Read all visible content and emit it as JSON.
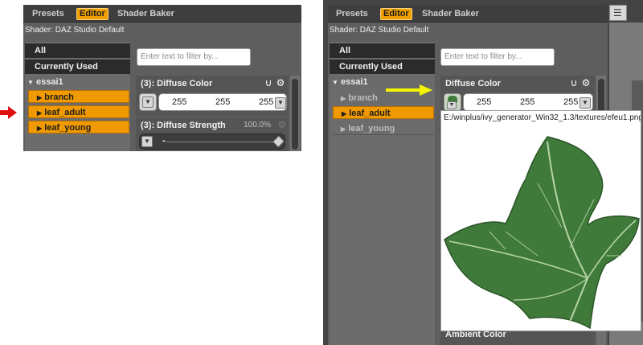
{
  "left": {
    "tabs": {
      "presets": "Presets",
      "editor": "Editor",
      "shader_baker": "Shader Baker"
    },
    "shader_label": "Shader: DAZ Studio Default",
    "filter_placeholder": "Enter text to filter by...",
    "list": {
      "all": "All",
      "currently_used": "Currently Used",
      "group": "essai1",
      "items": [
        "branch",
        "leaf_adult",
        "leaf_young"
      ]
    },
    "props": {
      "diffuse_color": {
        "label": "(3): Diffuse Color",
        "r": "255",
        "g": "255",
        "b": "255"
      },
      "diffuse_strength": {
        "label": "(3): Diffuse Strength",
        "value": "100.0%",
        "slider_value": "-"
      }
    }
  },
  "right": {
    "tabs": {
      "presets": "Presets",
      "editor": "Editor",
      "shader_baker": "Shader Baker"
    },
    "shader_label": "Shader: DAZ Studio Default",
    "filter_placeholder": "Enter text to filter by...",
    "list": {
      "all": "All",
      "currently_used": "Currently Used",
      "group": "essai1",
      "items": [
        "branch",
        "leaf_adult",
        "leaf_young"
      ]
    },
    "props": {
      "diffuse_color": {
        "label": "Diffuse Color",
        "r": "255",
        "g": "255",
        "b": "255"
      },
      "ambient_color": {
        "label": "Ambient Color"
      }
    },
    "tooltip_path": "E:/winplus/ivy_generator_Win32_1.3/textures/efeu1.png"
  },
  "colors": {
    "accent": "#f09a00",
    "red_arrow": "#e01010",
    "yellow_arrow": "#f5f500",
    "leaf": "#3f7a3a"
  }
}
